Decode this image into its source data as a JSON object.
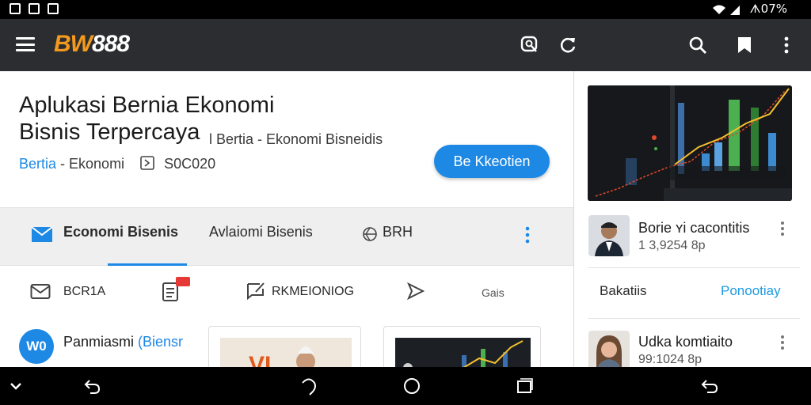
{
  "status_bar": {
    "right_text": "ᗑ07%"
  },
  "app_bar": {
    "logo_part1": "BW",
    "logo_part2": "888",
    "icons": [
      "menu-icon",
      "chat-search-icon",
      "refresh-icon",
      "search-icon",
      "bookmark-icon",
      "more-vert-icon"
    ]
  },
  "hero": {
    "headline_line1": "Aplukasi Bernia Ekonomi",
    "headline_line2": "Bisnis Terpercaya",
    "subline": "l Bertia - Ekonomi Bisneidis",
    "meta_link": "Bertia",
    "meta_text": " - Ekonomi",
    "meta_count": "S0C020",
    "cta_label": "Be Kkeotien"
  },
  "tabs": [
    {
      "label": "Economi Bisenis",
      "active": true
    },
    {
      "label": "Avlaiomi Bisenis",
      "active": false
    },
    {
      "label": "BRH",
      "active": false
    }
  ],
  "row2": {
    "items": [
      "BCR1A",
      "RKMEIONIOG",
      "Gais"
    ]
  },
  "list": {
    "avatar_text": "W0",
    "title": "Panmiasmi ",
    "title_link": "(Biensr"
  },
  "sidebar": {
    "item1": {
      "title": "Borie ʏi cacontitis",
      "sub": "1 3,9254 8p"
    },
    "section_label": "Bakatiis",
    "section_link": "Ponootiay",
    "item2": {
      "title": "Udka komtiaito",
      "sub": "99:1024 8p"
    }
  },
  "colors": {
    "appbar": "#2b2d30",
    "accent": "#1e88e5",
    "logo_orange": "#f39a1e"
  }
}
